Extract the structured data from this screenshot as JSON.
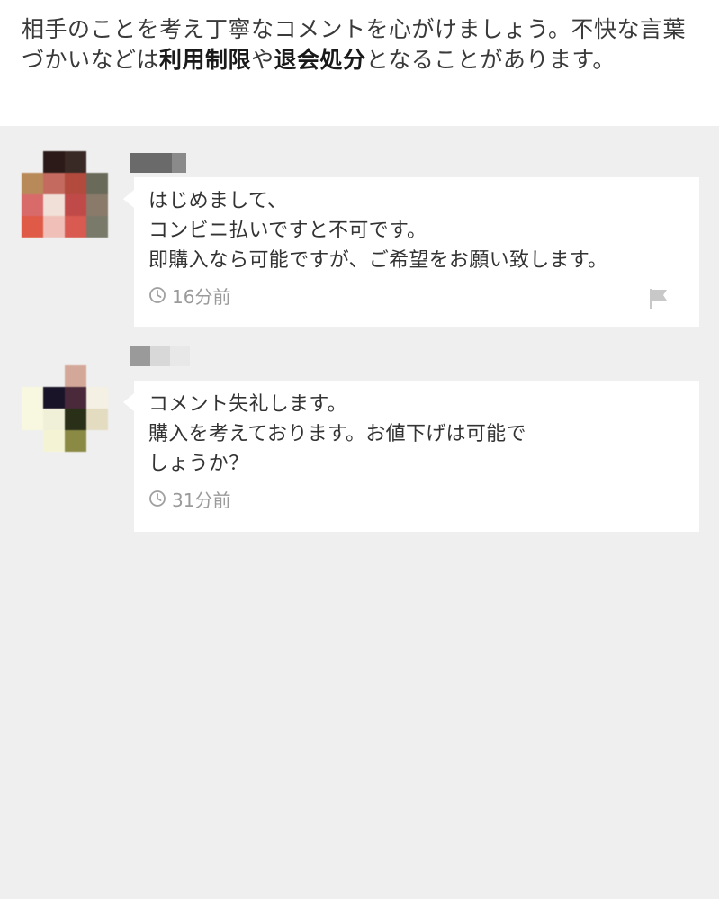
{
  "notice": {
    "text_1": "相手のことを考え丁寧なコメントを心がけましょう。不快な言葉づかいなどは",
    "bold_1": "利用制限",
    "text_2": "や",
    "bold_2": "退会処分",
    "text_3": "となることがあります。"
  },
  "comments": [
    {
      "body": "はじめまして、\nコンビニ払いですと不可です。\n即購入なら可能ですが、ご希望をお願い致します。",
      "time": "16分前",
      "avatar_colors": [
        "#efefef",
        "#2c1a18",
        "#3a2a26",
        "#efefef",
        "#b88a5a",
        "#c46a5e",
        "#b24a3e",
        "#6a6a5a",
        "#d96a6a",
        "#f0e0d8",
        "#c04a48",
        "#8a7a6a",
        "#e05a48",
        "#f0c0b8",
        "#d85a50",
        "#7a7a6a"
      ],
      "username_colors": [
        "#6a6a6a",
        "#8a8a8a",
        "#efefef"
      ]
    },
    {
      "body": "コメント失礼します。\n購入を考えております。お値下げは可能で\nしょうか？",
      "time": "31分前",
      "avatar_colors": [
        "#efefef",
        "#efefef",
        "#d4a898",
        "#efefef",
        "#f8f8e0",
        "#1a1428",
        "#4a2a3a",
        "#f4f0e4",
        "#f8f8e0",
        "#f0f0d8",
        "#2a3018",
        "#e4dcc0",
        "#efefef",
        "#f4f4d4",
        "#8a8a44",
        "#efefef"
      ],
      "username_colors": [
        "#9a9a9a",
        "#d8d8d8",
        "#e8e8e8"
      ]
    }
  ],
  "icons": {
    "clock": "clock-icon",
    "flag": "flag-icon"
  }
}
